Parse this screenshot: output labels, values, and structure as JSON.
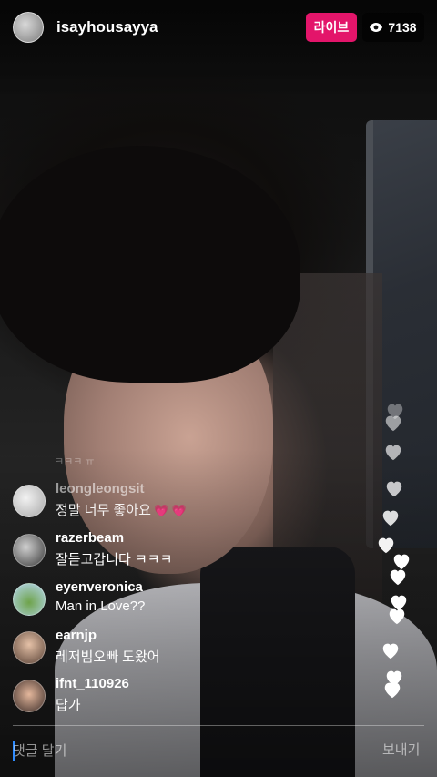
{
  "header": {
    "username": "isayhousayya",
    "live_label": "라이브",
    "viewer_count": "7138",
    "viewer_icon": "eye-icon"
  },
  "faded_comment": "ㅋㅋㅋ ㅠ",
  "comments": [
    {
      "username": "leongleongsit",
      "text": "정말 너무 좋아요",
      "emoji": "💗 💗"
    },
    {
      "username": "razerbeam",
      "text": "잘듣고갑니다 ㅋㅋㅋ"
    },
    {
      "username": "eyenveronica",
      "text": "Man in Love??"
    },
    {
      "username": "earnjp",
      "text": "레저빔오빠 도왔어"
    },
    {
      "username": "ifnt_110926",
      "text": "답가"
    }
  ],
  "comment_bar": {
    "placeholder": "댓글 달기",
    "send_label": "보내기"
  },
  "colors": {
    "live_badge": "#e3156a",
    "heart": "#ffffff",
    "cursor": "#2f8cff"
  }
}
